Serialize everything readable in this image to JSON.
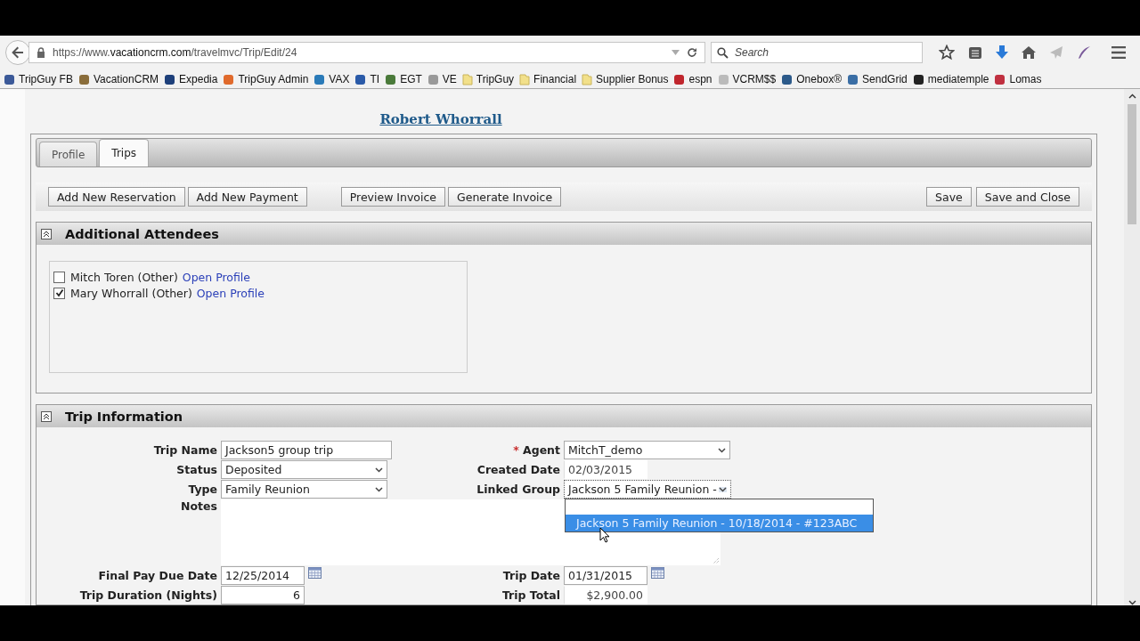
{
  "browser": {
    "url_prefix": "https://www.",
    "url_domain": "vacationcrm.com",
    "url_path": "/travelmvc/Trip/Edit/24",
    "search_placeholder": "Search"
  },
  "bookmarks": [
    {
      "label": "TripGuy FB",
      "kind": "site",
      "color": "#3b5998"
    },
    {
      "label": "VacationCRM",
      "kind": "site",
      "color": "#8a6d3b"
    },
    {
      "label": "Expedia",
      "kind": "site",
      "color": "#1d3f7a"
    },
    {
      "label": "TripGuy Admin",
      "kind": "site",
      "color": "#e06a2c"
    },
    {
      "label": "VAX",
      "kind": "site",
      "color": "#2a7ab8"
    },
    {
      "label": "TI",
      "kind": "site",
      "color": "#2a5aa8"
    },
    {
      "label": "EGT",
      "kind": "site",
      "color": "#4a7a3a"
    },
    {
      "label": "VE",
      "kind": "site",
      "color": "#999999"
    },
    {
      "label": "TripGuy",
      "kind": "folder",
      "color": "#f2e08a"
    },
    {
      "label": "Financial",
      "kind": "folder",
      "color": "#f2e08a"
    },
    {
      "label": "Supplier Bonus",
      "kind": "folder",
      "color": "#f2e08a"
    },
    {
      "label": "espn",
      "kind": "site",
      "color": "#c0262d"
    },
    {
      "label": "VCRM$$",
      "kind": "site",
      "color": "#bbbbbb"
    },
    {
      "label": "Onebox®",
      "kind": "site",
      "color": "#2c5a8a"
    },
    {
      "label": "SendGrid",
      "kind": "site",
      "color": "#3a6ea5"
    },
    {
      "label": "mediatemple",
      "kind": "site",
      "color": "#222222"
    },
    {
      "label": "Lomas",
      "kind": "site",
      "color": "#c03040"
    }
  ],
  "customer_link": "Robert Whorrall",
  "tabs": [
    {
      "label": "Profile",
      "selected": false
    },
    {
      "label": "Trips",
      "selected": true
    }
  ],
  "toolbar_left": [
    "Add New Reservation",
    "Add New Payment"
  ],
  "toolbar_middle": [
    "Preview Invoice",
    "Generate Invoice"
  ],
  "toolbar_right": [
    "Save",
    "Save and Close"
  ],
  "attendees_section": {
    "title": "Additional Attendees",
    "expanded": true,
    "attendees": [
      {
        "name": "Mitch Toren (Other)",
        "checked": false,
        "link": "Open Profile"
      },
      {
        "name": "Mary Whorrall (Other)",
        "checked": true,
        "link": "Open Profile"
      }
    ]
  },
  "trip_section": {
    "title": "Trip Information",
    "expanded": true,
    "rows": [
      {
        "left": {
          "label": "Trip Name",
          "kind": "text",
          "value": "Jackson5 group trip"
        },
        "right": {
          "label": "Agent",
          "required_mark": "*",
          "kind": "select",
          "value": "MitchT_demo"
        }
      },
      {
        "left": {
          "label": "Status",
          "kind": "select",
          "value": "Deposited"
        },
        "right": {
          "label": "Created Date",
          "kind": "readonly",
          "value": "02/03/2015"
        }
      },
      {
        "left": {
          "label": "Type",
          "kind": "select",
          "value": "Family Reunion"
        },
        "right": {
          "label": "Linked Group",
          "kind": "open_select",
          "value": "Jackson 5 Family Reunion -",
          "options": [
            {
              "label": "Jackson 5 Family Reunion - 10/18/2014 - #123ABC",
              "selected": true
            }
          ]
        }
      },
      {
        "left": {
          "label": "Notes",
          "kind": "textarea"
        }
      },
      {
        "left": {
          "label": "Final Pay Due Date",
          "kind": "date",
          "value": "12/25/2014"
        },
        "right": {
          "label": "Trip Date",
          "kind": "date",
          "value": "01/31/2015"
        }
      },
      {
        "left": {
          "label": "Trip Duration (Nights)",
          "kind": "number",
          "value": "6"
        },
        "right": {
          "label": "Trip Total",
          "kind": "readonly_number",
          "value": "$2,900.00"
        }
      }
    ]
  }
}
